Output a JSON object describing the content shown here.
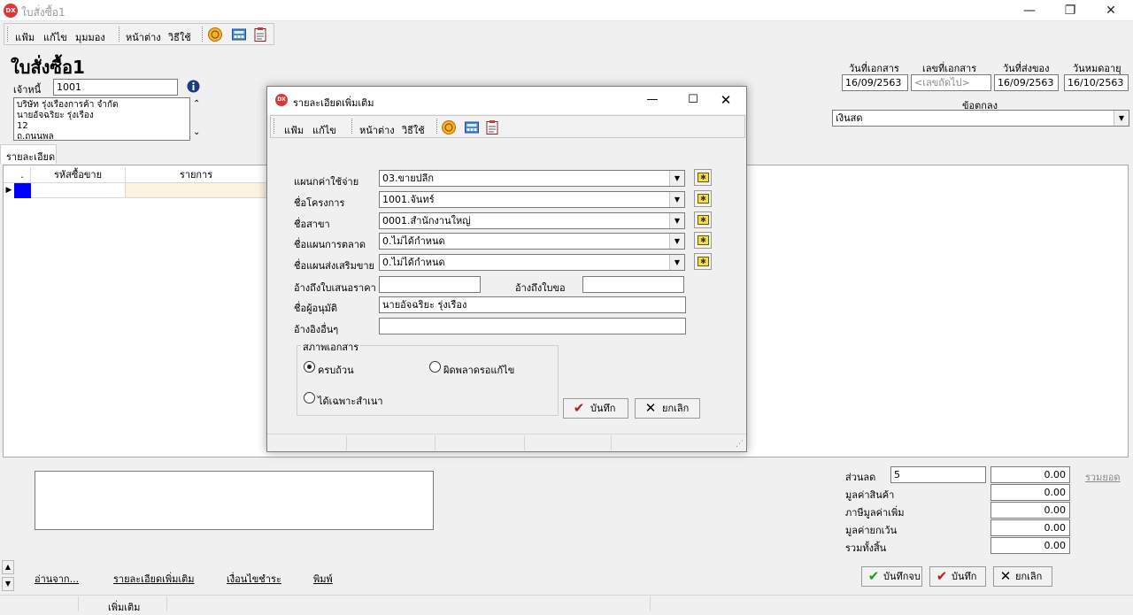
{
  "window": {
    "title": "ใบสั่งซื้อ1",
    "app_icon_text": "DX",
    "controls": {
      "minimize": "—",
      "maximize": "❐",
      "close": "✕"
    }
  },
  "menu": {
    "items": [
      "แฟ้ม",
      "แก้ไข",
      "มุมมอง"
    ],
    "items2": [
      "หน้าต่าง",
      "วิธีใช้"
    ]
  },
  "form": {
    "title": "ใบสั่งซื้อ1",
    "creditor_label": "เจ้าหนี้",
    "creditor_value": "1001",
    "address_lines": [
      "บริษัท รุ่งเรืองการค้า จำกัด",
      "นายอัจฉริยะ รุ่งเรือง",
      "12",
      "ถ.ถนนพล"
    ],
    "header_fields": {
      "doc_date_label": "วันที่เอกสาร",
      "doc_date_value": "16/09/2563",
      "doc_no_label": "เลขที่เอกสาร",
      "doc_no_placeholder": "<เลขถัดไป>",
      "delivery_date_label": "วันที่ส่งของ",
      "delivery_date_value": "16/09/2563",
      "expiry_date_label": "วันหมดอายุ",
      "expiry_date_value": "16/10/2563",
      "agreement_label": "ข้อตกลง",
      "agreement_value": "เงินสด"
    }
  },
  "tabs": {
    "detail": "รายละเอียด"
  },
  "grid": {
    "columns": [
      ".",
      "รหัสซื้อขาย",
      "รายการ"
    ]
  },
  "summary": {
    "discount_label": "ส่วนลด",
    "discount_input": "5",
    "discount_value": "0.00",
    "total_link": "รวมยอด",
    "product_value_label": "มูลค่าสินค้า",
    "product_value": "0.00",
    "vat_label": "ภาษีมูลค่าเพิ่ม",
    "vat_value": "0.00",
    "exempt_label": "มูลค่ายกเว้น",
    "exempt_value": "0.00",
    "grand_total_label": "รวมทั้งสิ้น",
    "grand_total_value": "0.00"
  },
  "bottom_links": {
    "read_from": "อ่านจาก...",
    "more_detail": "รายละเอียดเพิ่มเติม",
    "payment_terms": "เงื่อนไขชำระ",
    "print": "พิมพ์"
  },
  "bottom_buttons": {
    "save_close": "บันทึกจบ",
    "save": "บันทึก",
    "cancel": "ยกเลิก"
  },
  "statusbar": {
    "panel1": "เพิ่มเติม"
  },
  "dialog": {
    "title": "รายละเอียดเพิ่มเติม",
    "icon_text": "DX",
    "menu_items": [
      "แฟ้ม",
      "แก้ไข"
    ],
    "menu_items2": [
      "หน้าต่าง",
      "วิธีใช้"
    ],
    "fields": {
      "expense_plan_label": "แผนกค่าใช้จ่าย",
      "expense_plan_value": "03.ขายปลีก",
      "project_label": "ชื่อโครงการ",
      "project_value": "1001.จันทร์",
      "branch_label": "ชื่อสาขา",
      "branch_value": "0001.สำนักงานใหญ่",
      "marketing_plan_label": "ชื่อแผนการตลาด",
      "marketing_plan_value": "0.ไม่ได้กำหนด",
      "promo_plan_label": "ชื่อแผนส่งเสริมขาย",
      "promo_plan_value": "0.ไม่ได้กำหนด",
      "quote_ref_label": "อ้างถึงใบเสนอราคา",
      "quote_ref_value": "",
      "request_ref_label": "อ้างถึงใบขอ",
      "request_ref_value": "",
      "approver_label": "ชื่อผู้อนุมัติ",
      "approver_value": "นายอัจฉริยะ รุ่งเรือง",
      "other_ref_label": "อ้างอิงอื่นๆ",
      "other_ref_value": ""
    },
    "doc_status": {
      "title": "สภาพเอกสาร",
      "complete": "ครบถ้วน",
      "error": "ผิดพลาดรอแก้ไข",
      "copy_only": "ได้เฉพาะสำเนา",
      "selected": "complete"
    },
    "buttons": {
      "save": "บันทึก",
      "cancel": "ยกเลิก"
    }
  }
}
